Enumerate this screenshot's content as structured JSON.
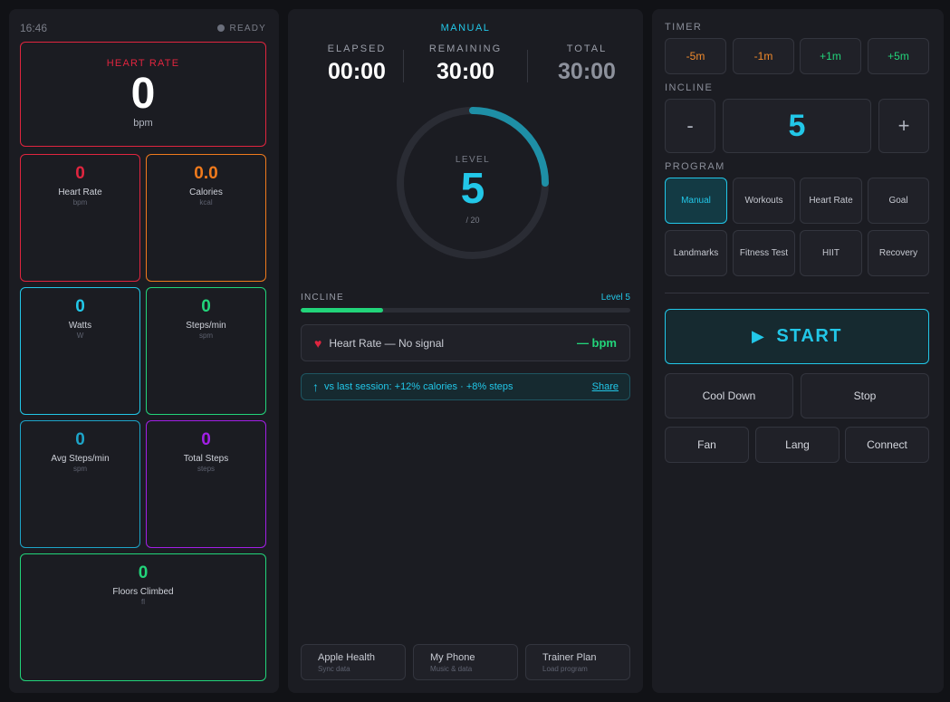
{
  "status": {
    "time": "16:46",
    "state": "READY"
  },
  "heart_rate_main": {
    "label": "HEART RATE",
    "value": "0",
    "unit": "bpm"
  },
  "metrics": [
    {
      "value": "0",
      "label": "Heart Rate",
      "unit": "bpm",
      "color": "#e0253f"
    },
    {
      "value": "0.0",
      "label": "Calories",
      "unit": "kcal",
      "color": "#f07a1c"
    },
    {
      "value": "0",
      "label": "Watts",
      "unit": "W",
      "color": "#22c7e8"
    },
    {
      "value": "0",
      "label": "Steps/min",
      "unit": "spm",
      "color": "#22d47a"
    },
    {
      "value": "0",
      "label": "Avg Steps/min",
      "unit": "spm",
      "color": "#1da4c8"
    },
    {
      "value": "0",
      "label": "Total Steps",
      "unit": "steps",
      "color": "#a21fe6"
    },
    {
      "value": "0",
      "label": "Floors Climbed",
      "unit": "fl",
      "color": "#22d47a"
    }
  ],
  "center": {
    "mode": "MANUAL",
    "elapsed": {
      "label": "ELAPSED",
      "value": "00:00"
    },
    "remaining": {
      "label": "REMAINING",
      "value": "30:00"
    },
    "total": {
      "label": "TOTAL",
      "value": "30:00"
    },
    "level": {
      "label": "LEVEL",
      "value": "5",
      "max": "/ 20",
      "fraction": 0.25
    },
    "incline": {
      "label": "INCLINE",
      "level_text": "Level 5",
      "fraction": 0.25
    },
    "hr_status": {
      "icon": "heart-icon",
      "text": "Heart Rate — No signal",
      "bpm": "— bpm"
    },
    "comparison": {
      "icon": "arrow-up-icon",
      "text": "vs last session: +12% calories · +8% steps",
      "link": "Share"
    },
    "integrations": [
      {
        "title": "Apple Health",
        "subtitle": "Sync data"
      },
      {
        "title": "My Phone",
        "subtitle": "Music & data"
      },
      {
        "title": "Trainer Plan",
        "subtitle": "Load program"
      }
    ]
  },
  "controls": {
    "timer_label": "TIMER",
    "timer_buttons": [
      "-5m",
      "-1m",
      "+1m",
      "+5m"
    ],
    "incline_label": "INCLINE",
    "incline_minus": "-",
    "incline_value": "5",
    "incline_plus": "+",
    "program_label": "PROGRAM",
    "programs": [
      "Manual",
      "Workouts",
      "Heart Rate",
      "Goal",
      "Landmarks",
      "Fitness Test",
      "HIIT",
      "Recovery"
    ],
    "start_label": "START",
    "cool_down": "Cool Down",
    "stop": "Stop",
    "fan": "Fan",
    "lang": "Lang",
    "connect": "Connect"
  },
  "colors": {
    "accent": "#22c7e8",
    "green": "#22d47a",
    "red": "#e0253f",
    "orange": "#f07a1c",
    "purple": "#a21fe6"
  }
}
